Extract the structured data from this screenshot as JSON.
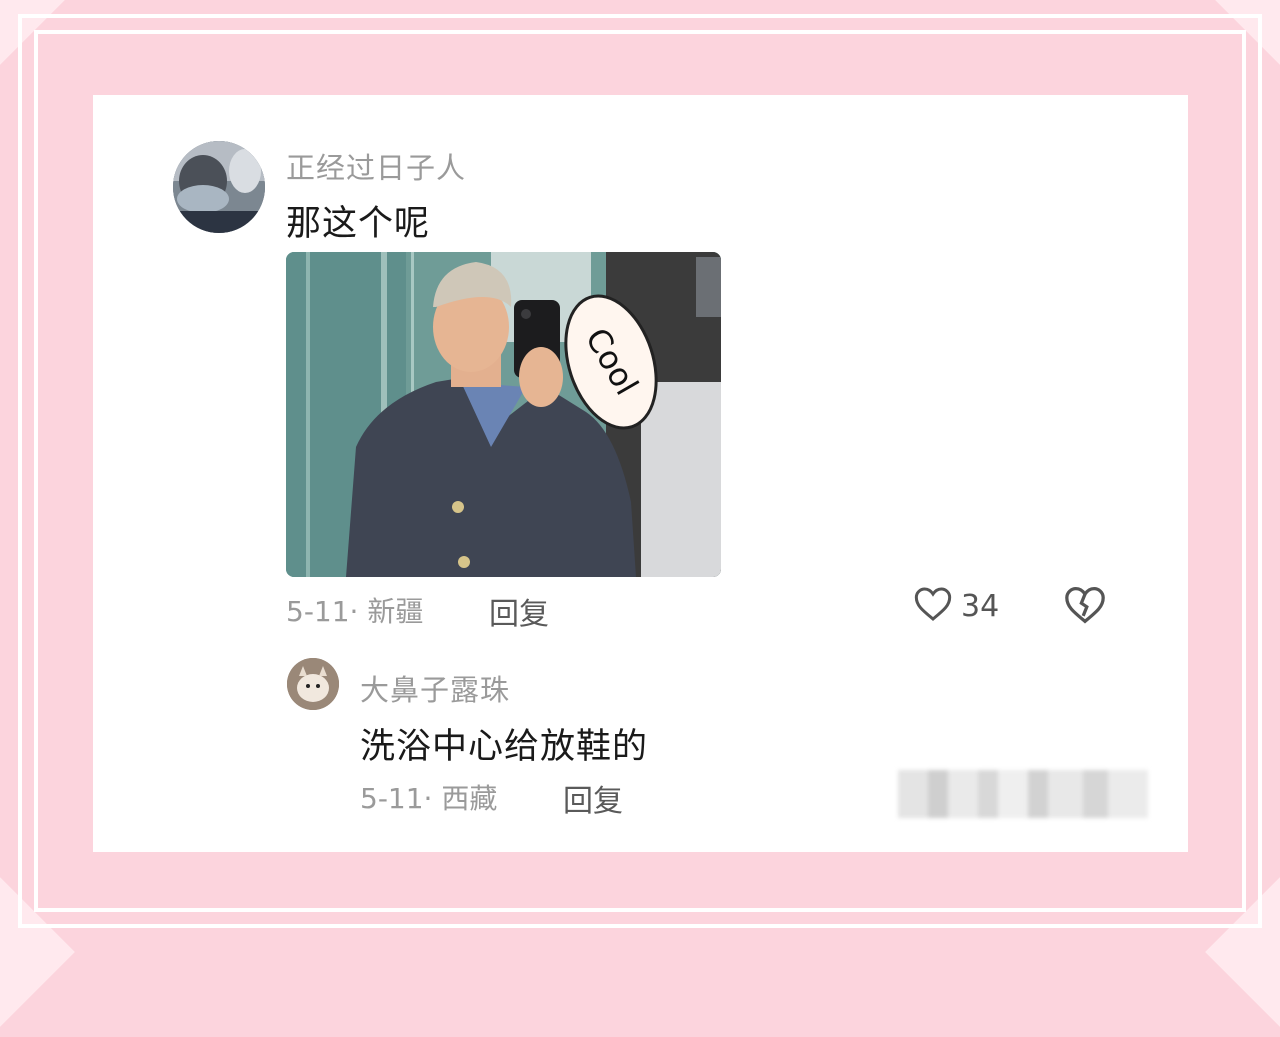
{
  "comment": {
    "username": "正经过日子人",
    "text": "那这个呢",
    "date_location": "5-11· 新疆",
    "reply_label": "回复",
    "like_count": "34",
    "photo_sticker_text": "Cool"
  },
  "sub_reply": {
    "username": "大鼻子露珠",
    "text": "洗浴中心给放鞋的",
    "date_location": "5-11· 西藏",
    "reply_label": "回复"
  },
  "icons": {
    "like": "heart-icon",
    "dislike": "broken-heart-icon"
  },
  "colors": {
    "frame": "#fcd4dd",
    "card": "#ffffff",
    "username": "#9a9a9a",
    "text": "#1a1a1a"
  }
}
